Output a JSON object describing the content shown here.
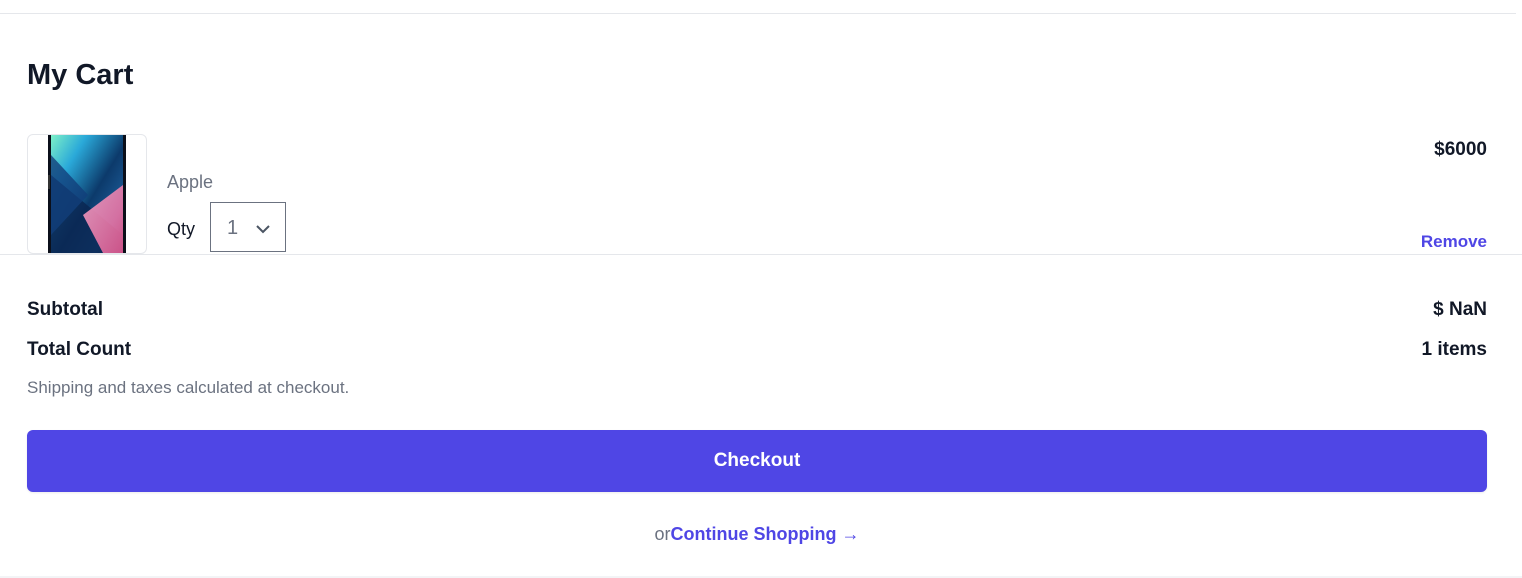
{
  "cart": {
    "title": "My Cart",
    "items": [
      {
        "brand": "Apple",
        "qty_label": "Qty",
        "qty_value": "1",
        "price": "$6000",
        "remove_label": "Remove",
        "image_icon": "iphone-product-image"
      }
    ]
  },
  "summary": {
    "subtotal_label": "Subtotal",
    "subtotal_value": "$ NaN",
    "count_label": "Total Count",
    "count_value": "1 items",
    "shipping_note": "Shipping and taxes calculated at checkout."
  },
  "actions": {
    "checkout_label": "Checkout",
    "or_text": "or",
    "continue_label": "Continue Shopping →"
  },
  "colors": {
    "accent": "#4f46e5",
    "text_primary": "#111827",
    "text_muted": "#6b7280",
    "border": "#e5e7eb"
  }
}
